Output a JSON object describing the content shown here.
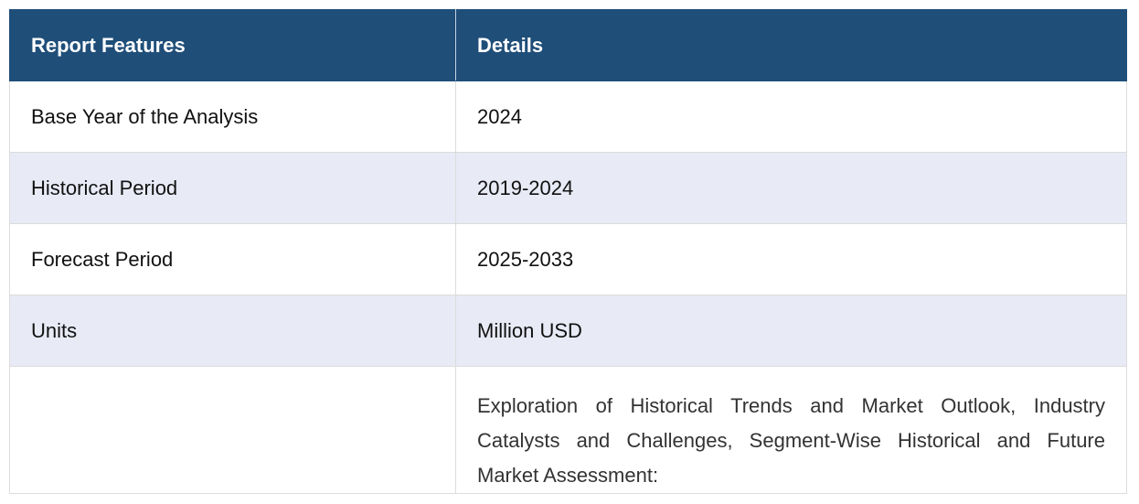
{
  "table": {
    "headers": [
      "Report Features",
      "Details"
    ],
    "rows": [
      {
        "feature": "Base Year of the Analysis",
        "detail": "2024"
      },
      {
        "feature": "Historical Period",
        "detail": "2019-2024"
      },
      {
        "feature": "Forecast Period",
        "detail": "2025-2033"
      },
      {
        "feature": "Units",
        "detail": "Million USD"
      },
      {
        "feature": "",
        "detail": "Exploration of Historical Trends and Market Outlook, Industry Catalysts and Challenges, Segment-Wise Historical and Future Market Assessment:"
      }
    ]
  },
  "colors": {
    "header_bg": "#1f4e79",
    "header_text": "#ffffff",
    "shaded_row": "#e8eaf6",
    "border": "#dcdcdc"
  }
}
